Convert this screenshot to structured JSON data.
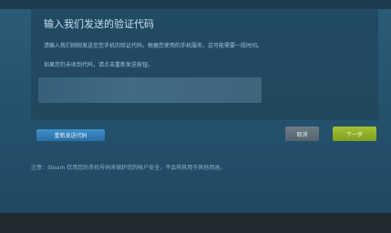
{
  "dialog": {
    "title": "输入我们发送的验证代码",
    "line1": "请输入我们刚刚发送至您手机的验证代码。根据您使用的手机服务，这可能需要一段时间。",
    "line2": "如果您仍未收到代码，请点击重新发送按钮。",
    "code_input_value": ""
  },
  "buttons": {
    "resend_label": "重新发送代码",
    "cancel_label": "取消",
    "next_label": "下一步"
  },
  "note": "注意：Steam 仅用您的手机号码来保护您的帐户安全，不会将其用于其他用途。",
  "colors": {
    "background": "#23506b",
    "panel": "#214a63",
    "resend_button": "#3a88c2",
    "cancel_button": "#627079",
    "next_button": "#90b02b"
  }
}
